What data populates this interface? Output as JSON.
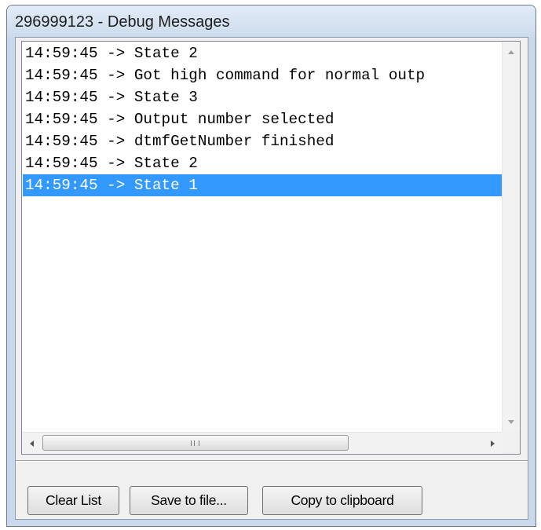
{
  "window": {
    "title": "296999123 - Debug Messages"
  },
  "log": {
    "lines": [
      "14:59:45 -> State 2",
      "14:59:45 -> Got high command for normal outp",
      "14:59:45 -> State 3",
      "14:59:45 -> Output number selected",
      "14:59:45 -> dtmfGetNumber finished",
      "14:59:45 -> State 2",
      "14:59:45 -> State 1"
    ],
    "selected_index": 6
  },
  "horizontal_scrollbar": {
    "thumb_grip": "III"
  },
  "buttons": {
    "clear_label": "Clear List",
    "save_label": "Save to file...",
    "copy_label": "Copy to clipboard"
  },
  "colors": {
    "selection": "#3399ff",
    "window_frame": "#c9d8ea"
  }
}
